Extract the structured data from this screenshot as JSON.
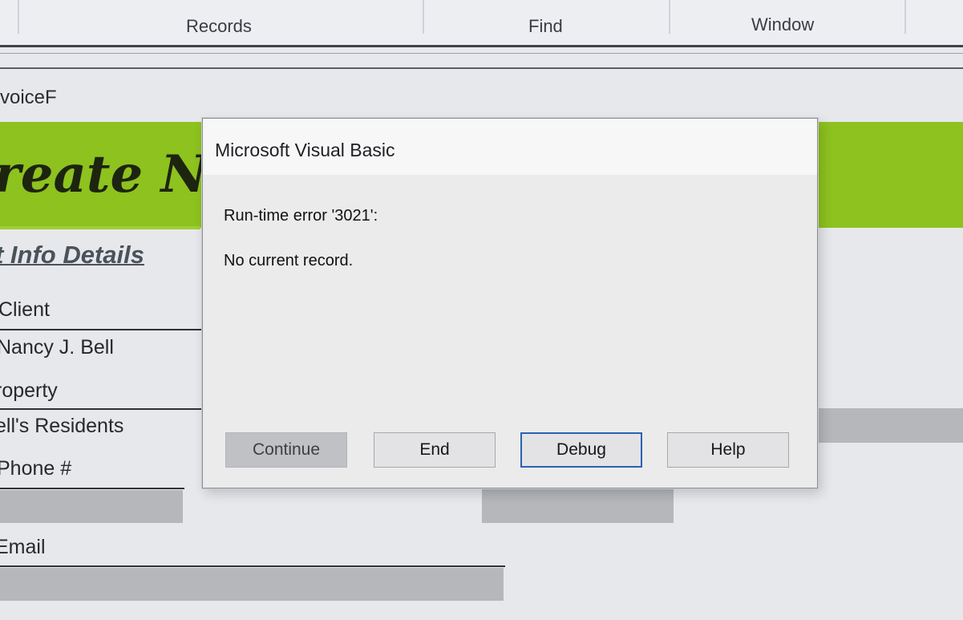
{
  "menu": {
    "items": [
      "Records",
      "Find",
      "Window"
    ]
  },
  "form": {
    "tab_label": "voiceF",
    "title": "reate N",
    "section_heading": "t Info Details",
    "fields": {
      "client_label": "Client",
      "client_value": "Nancy J. Bell",
      "property_label": "roperty",
      "property_value": "ell's Residents",
      "phone_label": "Phone #",
      "email_label": "Email"
    }
  },
  "dialog": {
    "title": "Microsoft Visual Basic",
    "error_code": "Run-time error '3021':",
    "error_message": "No current record.",
    "buttons": {
      "continue": "Continue",
      "end": "End",
      "debug": "Debug",
      "help": "Help"
    }
  },
  "colors": {
    "accent_green": "#8dc21f",
    "focus_blue": "#2b62b4"
  }
}
